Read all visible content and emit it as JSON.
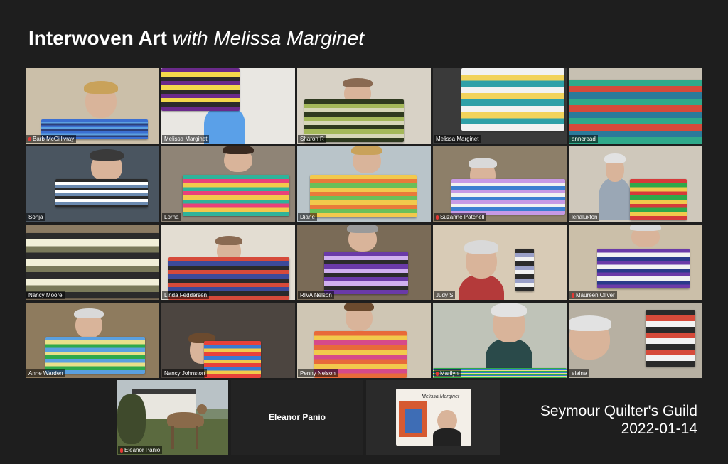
{
  "title": {
    "main": "Interwoven Art",
    "sub": "with Melissa Marginet"
  },
  "participants": [
    {
      "name": "Barb McGillivray",
      "muted": true
    },
    {
      "name": "Melissa Marginet",
      "muted": false
    },
    {
      "name": "Sharon R",
      "muted": false
    },
    {
      "name": "Melissa Marginet",
      "muted": false
    },
    {
      "name": "anneread",
      "muted": false
    },
    {
      "name": "Sonja",
      "muted": false
    },
    {
      "name": "Lorna",
      "muted": false
    },
    {
      "name": "Diane",
      "muted": false
    },
    {
      "name": "Suzanne Patchell",
      "muted": true
    },
    {
      "name": "lenaluxton",
      "muted": false
    },
    {
      "name": "Nancy Moore",
      "muted": false
    },
    {
      "name": "Linda Feddersen",
      "muted": false
    },
    {
      "name": "RIVA Nelson",
      "muted": false
    },
    {
      "name": "Judy S",
      "muted": false
    },
    {
      "name": "Maureen Oliver",
      "muted": true
    },
    {
      "name": "Anne Warden",
      "muted": false
    },
    {
      "name": "Nancy Johnston",
      "muted": false
    },
    {
      "name": "Penny Nelson",
      "muted": false
    },
    {
      "name": "Marilyn",
      "muted": true
    },
    {
      "name": "elaine",
      "muted": false
    }
  ],
  "bottom_row": {
    "deer_tile": {
      "name": "Eleanor Panio",
      "muted": true
    },
    "name_only_tile": {
      "name": "Eleanor Panio"
    },
    "logo_tile": {
      "logo_text": "Melissa Marginet"
    }
  },
  "guild": {
    "name": "Seymour Quilter's Guild",
    "date": "2022-01-14"
  },
  "colors": {
    "background": "#1e1e1e",
    "tile_dark": "#232323",
    "mic_muted": "#e53935"
  }
}
